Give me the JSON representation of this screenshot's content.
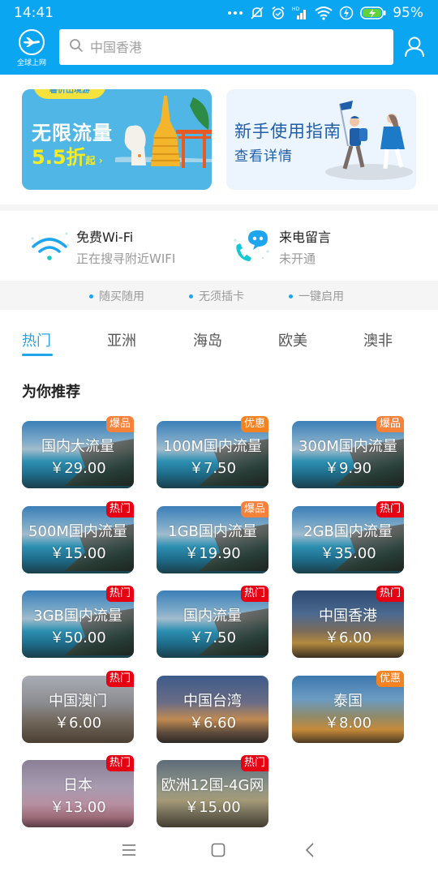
{
  "status_bar": {
    "time": "14:41",
    "battery_percent": "95%",
    "icons": [
      "more-dots-icon",
      "notifications-off-icon",
      "alarm-icon",
      "hd-signal-icon",
      "wifi-icon",
      "charging-icon",
      "battery-icon"
    ]
  },
  "header": {
    "logo_label": "全球上网",
    "search_placeholder": "中国香港",
    "search_icon": "search-icon",
    "user_icon": "user-icon"
  },
  "banners": [
    {
      "ribbon": "暑价出境游",
      "title": "无限流量",
      "discount": "5.5折",
      "discount_suffix": "起 ›"
    },
    {
      "title": "新手使用指南",
      "subtitle": "查看详情"
    }
  ],
  "services": [
    {
      "icon": "wifi-icon",
      "title": "免费Wi-Fi",
      "status": "正在搜寻附近WIFI"
    },
    {
      "icon": "voicemail-phone-icon",
      "title": "来电留言",
      "status": "未开通"
    }
  ],
  "features": [
    "随买随用",
    "无须插卡",
    "一键启用"
  ],
  "tabs": [
    {
      "label": "热门",
      "active": true
    },
    {
      "label": "亚洲",
      "active": false
    },
    {
      "label": "海岛",
      "active": false
    },
    {
      "label": "欧美",
      "active": false
    },
    {
      "label": "澳非",
      "active": false
    }
  ],
  "recommend": {
    "title": "为你推荐",
    "items": [
      {
        "name": "国内大流量",
        "price": "￥29.00",
        "badge": "爆品"
      },
      {
        "name": "100M国内流量",
        "price": "￥7.50",
        "badge": "优惠"
      },
      {
        "name": "300M国内流量",
        "price": "￥9.90",
        "badge": "爆品"
      },
      {
        "name": "500M国内流量",
        "price": "￥15.00",
        "badge": "热门"
      },
      {
        "name": "1GB国内流量",
        "price": "￥19.90",
        "badge": "爆品"
      },
      {
        "name": "2GB国内流量",
        "price": "￥35.00",
        "badge": "热门"
      },
      {
        "name": "3GB国内流量",
        "price": "￥50.00",
        "badge": "热门"
      },
      {
        "name": "国内流量",
        "price": "￥7.50",
        "badge": "热门"
      },
      {
        "name": "中国香港",
        "price": "￥6.00",
        "badge": "热门"
      },
      {
        "name": "中国澳门",
        "price": "￥6.00",
        "badge": "热门"
      },
      {
        "name": "中国台湾",
        "price": "￥6.60",
        "badge": ""
      },
      {
        "name": "泰国",
        "price": "￥8.00",
        "badge": "优惠"
      },
      {
        "name": "日本",
        "price": "￥13.00",
        "badge": "热门"
      },
      {
        "name": "欧洲12国-4G网",
        "price": "￥15.00",
        "badge": "热门"
      }
    ]
  },
  "nav_bar": {
    "buttons": [
      "menu-icon",
      "home-icon",
      "back-icon"
    ]
  },
  "colors": {
    "brand": "#0aa6f2",
    "accent": "#1ea5ee",
    "badge_hot": "#e60012",
    "badge_boom": "#f5823a",
    "badge_deal": "#f58220"
  }
}
